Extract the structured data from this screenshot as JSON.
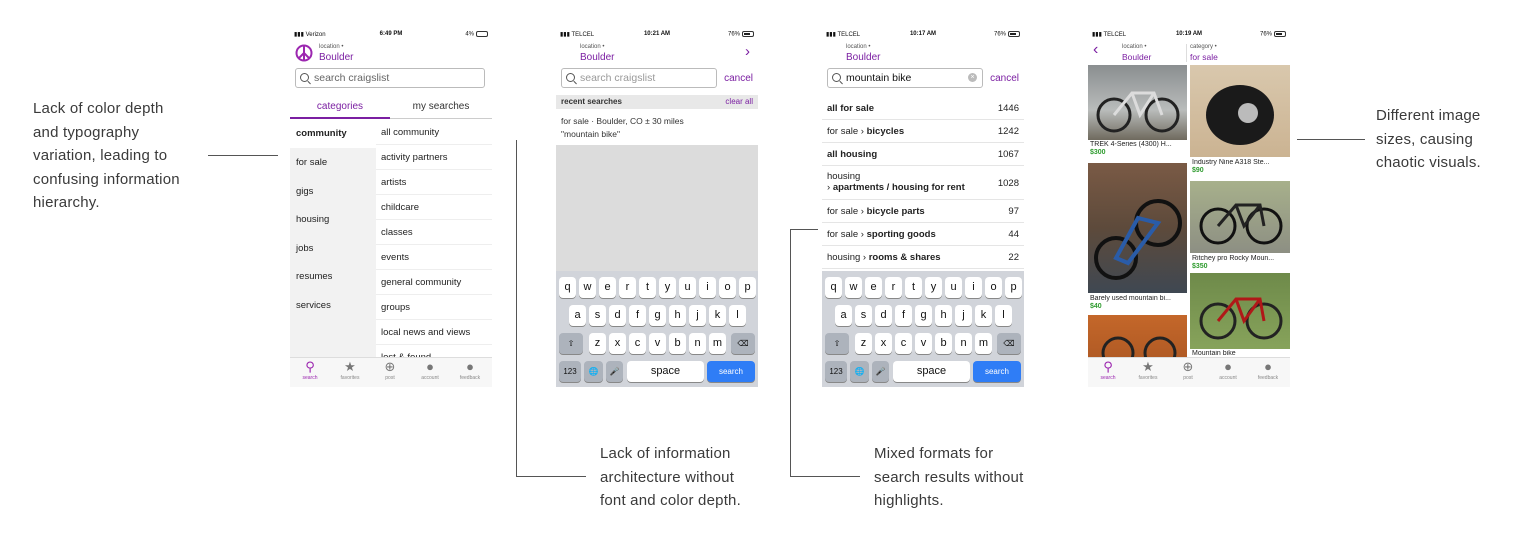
{
  "annotations": {
    "a1": [
      "Lack of color depth",
      "and typography",
      "variation, leading to",
      "confusing information",
      "hierarchy."
    ],
    "a2": [
      "Lack of information",
      "architecture without",
      "font and color depth."
    ],
    "a3": [
      "Mixed formats for",
      "search results without",
      "highlights."
    ],
    "a4": [
      "Different image",
      "sizes, causing",
      "chaotic visuals."
    ]
  },
  "phone1": {
    "carrier": "Verizon",
    "time": "6:49 PM",
    "battery": "4%",
    "location_label": "location",
    "location": "Boulder",
    "search_placeholder": "search craigslist",
    "tab_categories": "categories",
    "tab_my_searches": "my searches",
    "left": [
      "community",
      "for sale",
      "gigs",
      "housing",
      "jobs",
      "resumes",
      "services"
    ],
    "right": [
      "all community",
      "activity partners",
      "artists",
      "childcare",
      "classes",
      "events",
      "general community",
      "groups",
      "local news and views",
      "lost & found"
    ]
  },
  "phone2": {
    "carrier": "TELCEL",
    "time": "10:21 AM",
    "battery": "76%",
    "location_label": "location",
    "location": "Boulder",
    "search_placeholder": "search craigslist",
    "cancel": "cancel",
    "recent_header": "recent searches",
    "clear_all": "clear all",
    "recent_line1": "for sale · Boulder, CO ± 30 miles",
    "recent_line2": "\"mountain bike\""
  },
  "phone3": {
    "carrier": "TELCEL",
    "time": "10:17 AM",
    "battery": "76%",
    "location_label": "location",
    "location": "Boulder",
    "search_value": "mountain bike",
    "cancel": "cancel",
    "results": [
      {
        "prefix": "",
        "bold": "all for sale",
        "count": "1446"
      },
      {
        "prefix": "for sale ›",
        "bold": "bicycles",
        "count": "1242"
      },
      {
        "prefix": "",
        "bold": "all housing",
        "count": "1067"
      },
      {
        "prefix": "housing",
        "bold": "apartments / housing for rent",
        "count": "1028"
      },
      {
        "prefix": "for sale ›",
        "bold": "bicycle parts",
        "count": "97"
      },
      {
        "prefix": "for sale ›",
        "bold": "sporting goods",
        "count": "44"
      },
      {
        "prefix": "housing ›",
        "bold": "rooms & shares",
        "count": "22"
      }
    ]
  },
  "phone4": {
    "carrier": "TELCEL",
    "time": "10:19 AM",
    "battery": "76%",
    "location_label": "location",
    "location": "Boulder",
    "category_label": "category",
    "category": "for sale",
    "listings": [
      {
        "title": "TREK 4-Series (4300) H...",
        "price": "$300"
      },
      {
        "title": "Industry Nine A318 Ste...",
        "price": "$90"
      },
      {
        "title": "Barely used mountain bi...",
        "price": "$40"
      },
      {
        "title": "Ritchey pro Rocky Moun...",
        "price": "$350"
      },
      {
        "title": "Mountain bike",
        "price": ""
      }
    ]
  },
  "keyboard": {
    "row1": [
      "q",
      "w",
      "e",
      "r",
      "t",
      "y",
      "u",
      "i",
      "o",
      "p"
    ],
    "row2": [
      "a",
      "s",
      "d",
      "f",
      "g",
      "h",
      "j",
      "k",
      "l"
    ],
    "row3": [
      "z",
      "x",
      "c",
      "v",
      "b",
      "n",
      "m"
    ],
    "num": "123",
    "space": "space",
    "search": "search"
  },
  "tabbar": [
    "search",
    "favorites",
    "post",
    "account",
    "feedback"
  ],
  "colors": {
    "accent": "#7b1fa2",
    "keyboard_blue": "#2f7df6",
    "price_green": "#2e9b2e"
  }
}
